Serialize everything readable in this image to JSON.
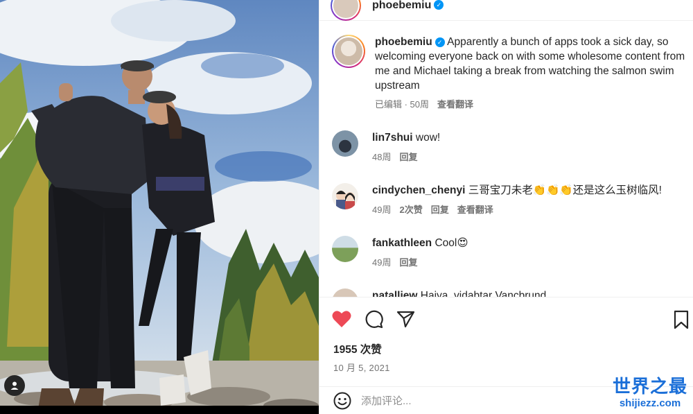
{
  "header": {
    "username": "phoebemiu",
    "verified": true
  },
  "caption": {
    "username": "phoebemiu",
    "text": "Apparently a bunch of apps took a sick day, so welcoming everyone back on with some wholesome content from me and Michael taking a break from watching the salmon swim upstream",
    "edited": "已编辑 · 50周",
    "translate": "查看翻译"
  },
  "comments": [
    {
      "username": "lin7shui",
      "text": "wow!",
      "time": "48周",
      "reply": "回复"
    },
    {
      "username": "cindychen_chenyi",
      "text": "三哥宝刀未老👏👏👏还是这么玉树临风!",
      "time": "49周",
      "likes": "2次赞",
      "reply": "回复",
      "translate": "查看翻译"
    },
    {
      "username": "fankathleen",
      "text": "Cool😍",
      "time": "49周",
      "reply": "回复"
    },
    {
      "username": "natalliew",
      "text": "Haiya, vidabtar Vancbrund",
      "time": "",
      "reply": ""
    }
  ],
  "actions": {
    "like_icon": "heart-filled-icon",
    "comment_icon": "comment-icon",
    "share_icon": "send-icon",
    "save_icon": "bookmark-icon"
  },
  "likes": "1955 次赞",
  "date": "10 月 5, 2021",
  "add_comment": {
    "emoji_icon": "smiley-icon",
    "placeholder": "添加评论..."
  },
  "watermark": {
    "title": "世界之最",
    "url": "shijiezz.com"
  },
  "colors": {
    "heart": "#ed4956",
    "verified": "#0095f6",
    "watermark": "#1b6fd8"
  }
}
